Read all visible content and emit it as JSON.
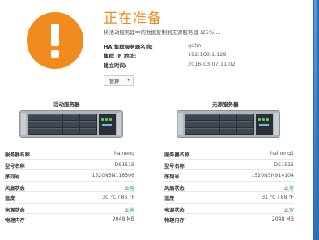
{
  "status": {
    "title": "正在准备",
    "description": "将活动服务器中的数据复制到无源服务器 (25%)...",
    "progress_percent": 25,
    "accent_color": "#f28b1d",
    "icon": "alert-icon"
  },
  "ha_info": [
    {
      "key": "HA 集群服务器名称:",
      "value": "qdhn"
    },
    {
      "key": "集群 IP 地址:",
      "value": "192.168.1.129"
    },
    {
      "key": "建立时间:",
      "value": "2016-03-07 11:02"
    }
  ],
  "manage_button": {
    "label": "管理",
    "caret_icon": "chevron-down-icon"
  },
  "servers": [
    {
      "title": "活动服务器",
      "rows": [
        {
          "key": "服务器名称",
          "value": "haineng",
          "status": false
        },
        {
          "key": "型号名称",
          "value": "DS1515",
          "status": false
        },
        {
          "key": "序列号",
          "value": "1520N5N118506",
          "status": false
        },
        {
          "key": "风扇状态",
          "value": "正常",
          "status": true
        },
        {
          "key": "温度",
          "value": "30 °C / 86 °F",
          "status": false
        },
        {
          "key": "电源状态",
          "value": "正常",
          "status": true
        },
        {
          "key": "物理内存",
          "value": "2048 MB",
          "status": false
        }
      ]
    },
    {
      "title": "无源服务器",
      "rows": [
        {
          "key": "服务器名称",
          "value": "haineng1",
          "status": false
        },
        {
          "key": "型号名称",
          "value": "DS1515",
          "status": false
        },
        {
          "key": "序列号",
          "value": "1520N5N914104",
          "status": false
        },
        {
          "key": "风扇状态",
          "value": "正常",
          "status": true
        },
        {
          "key": "温度",
          "value": "31 °C / 88 °F",
          "status": false
        },
        {
          "key": "电源状态",
          "value": "正常",
          "status": true
        },
        {
          "key": "物理内存",
          "value": "2048 MB",
          "status": false
        }
      ]
    }
  ],
  "colors": {
    "status_good": "#1f9b2f",
    "accent": "#f28b1d",
    "side_strip": "#2b6fb5"
  }
}
